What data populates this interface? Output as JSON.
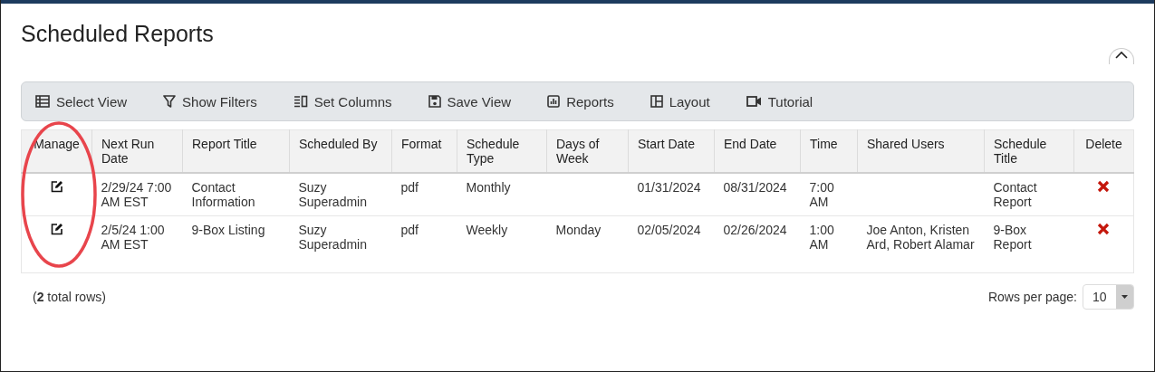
{
  "title": "Scheduled Reports",
  "toolbar": [
    "Select View",
    "Show Filters",
    "Set Columns",
    "Save View",
    "Reports",
    "Layout",
    "Tutorial"
  ],
  "table": {
    "columns": [
      {
        "label": "Manage",
        "kind": "edit"
      },
      {
        "label": "Next Run Date",
        "kind": "text"
      },
      {
        "label": "Report Title",
        "kind": "text"
      },
      {
        "label": "Scheduled By",
        "kind": "text"
      },
      {
        "label": "Format",
        "kind": "text"
      },
      {
        "label": "Schedule Type",
        "kind": "text"
      },
      {
        "label": "Days of Week",
        "kind": "text"
      },
      {
        "label": "Start Date",
        "kind": "text"
      },
      {
        "label": "End Date",
        "kind": "text"
      },
      {
        "label": "Time",
        "kind": "text"
      },
      {
        "label": "Shared Users",
        "kind": "text"
      },
      {
        "label": "Schedule Title",
        "kind": "text"
      },
      {
        "label": "Delete",
        "kind": "delete"
      }
    ],
    "rows": [
      [
        null,
        "2/29/24 7:00 AM EST",
        "Contact Information",
        "Suzy Superadmin",
        "pdf",
        "Monthly",
        null,
        "01/31/2024",
        "08/31/2024",
        "7:00 AM",
        null,
        "Contact Report",
        null
      ],
      [
        null,
        "2/5/24 1:00 AM EST",
        "9-Box Listing",
        "Suzy Superadmin",
        "pdf",
        "Weekly",
        "Monday",
        "02/05/2024",
        "02/26/2024",
        "1:00 AM",
        "Joe Anton, Kristen Ard, Robert Alamar",
        "9-Box Report",
        null
      ]
    ]
  },
  "footer": {
    "total": "(**2** total rows)",
    "rows_per_page_label": "Rows per page:",
    "rows_per_page": "10"
  }
}
